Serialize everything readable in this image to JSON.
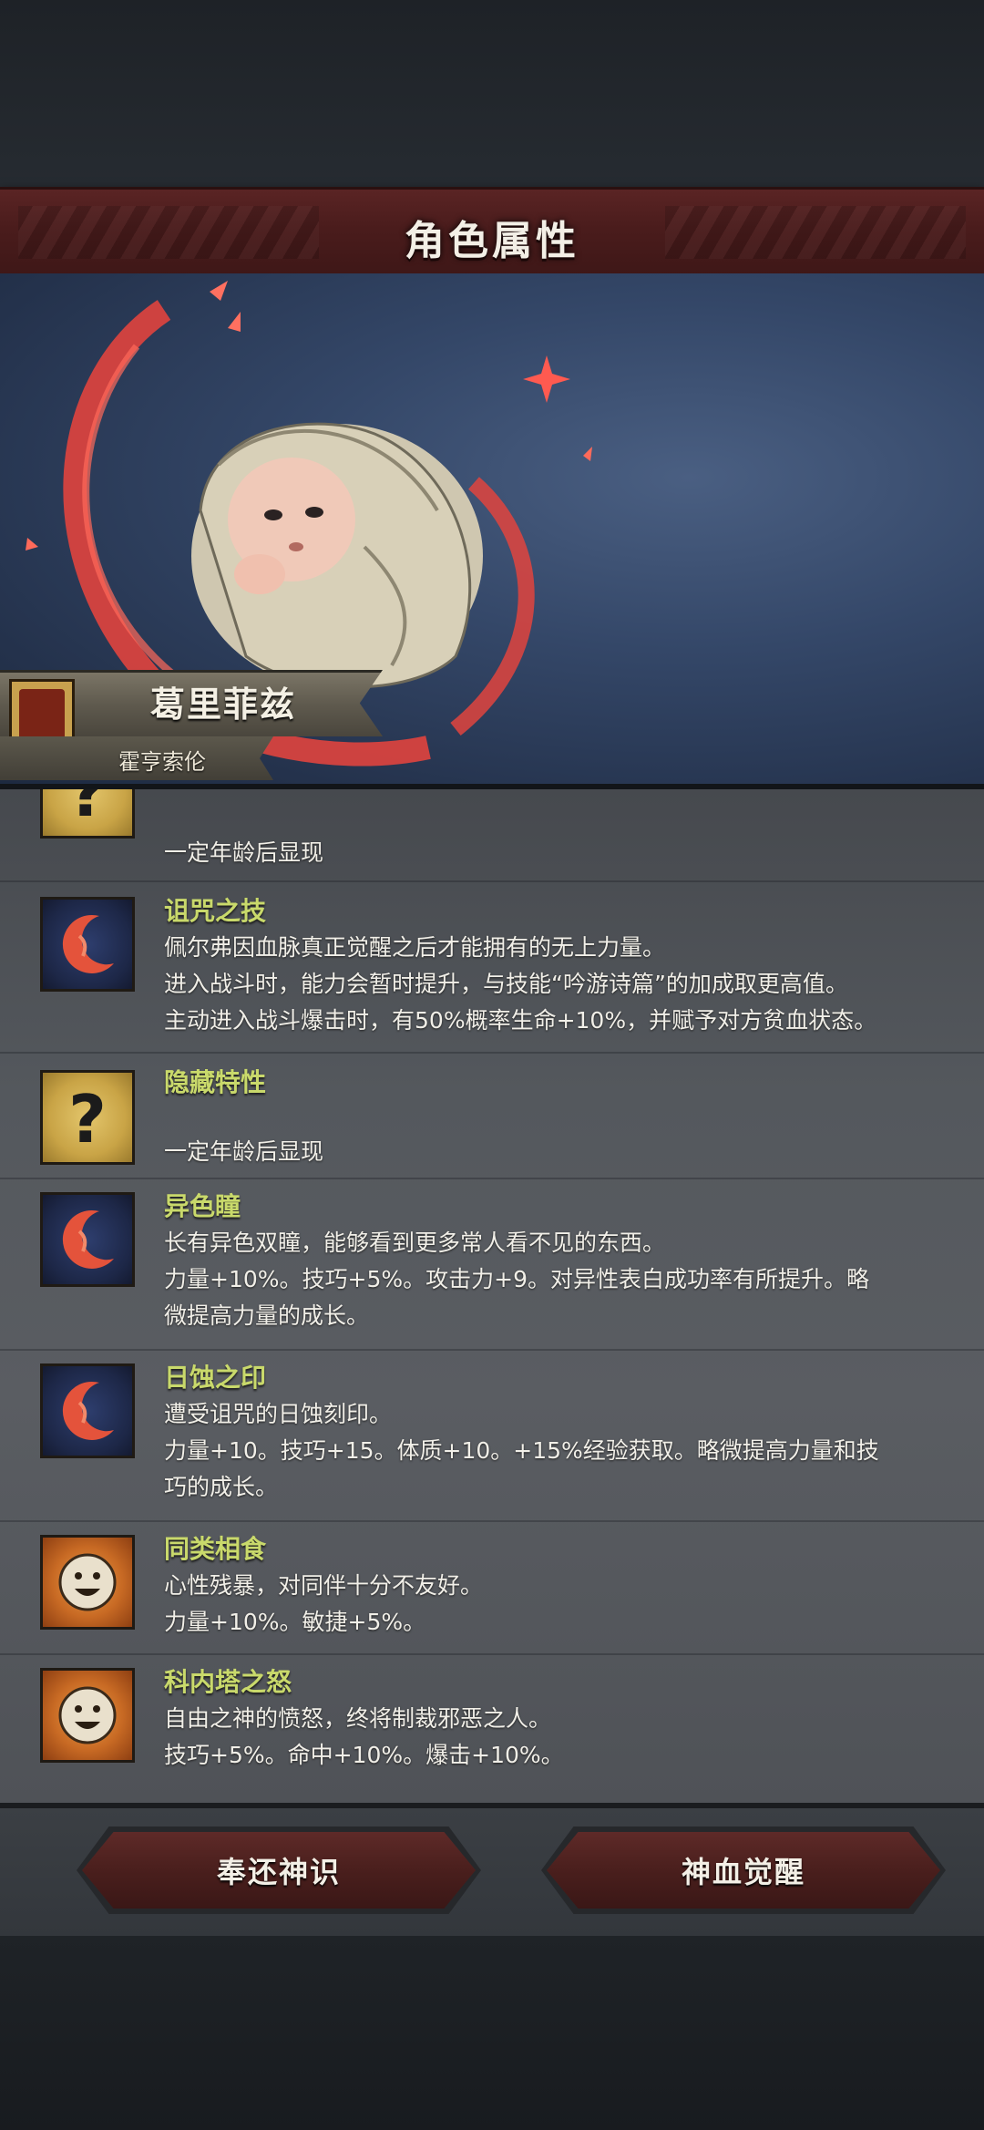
{
  "header": {
    "title": "角色属性"
  },
  "character": {
    "name": "葛里菲兹",
    "house": "霍亨索伦"
  },
  "traits": [
    {
      "icon": "question-icon",
      "name": "",
      "lines": [
        "一定年龄后显现"
      ]
    },
    {
      "icon": "crescent-flame-icon",
      "name": "诅咒之技",
      "lines": [
        "佩尔弗因血脉真正觉醒之后才能拥有的无上力量。",
        "进入战斗时，能力会暂时提升，与技能“吟游诗篇”的加成取更高值。",
        "主动进入战斗爆击时，有50%概率生命+10%，并赋予对方贫血状态。"
      ]
    },
    {
      "icon": "question-icon",
      "name": "隐藏特性",
      "lines": [
        "",
        "一定年龄后显现"
      ]
    },
    {
      "icon": "crescent-flame-icon",
      "name": "异色瞳",
      "lines": [
        "长有异色双瞳，能够看到更多常人看不见的东西。",
        "力量+10%。技巧+5%。攻击力+9。对异性表白成功率有所提升。略",
        "微提高力量的成长。"
      ]
    },
    {
      "icon": "crescent-flame-icon",
      "name": "日蚀之印",
      "lines": [
        "遭受诅咒的日蚀刻印。",
        "力量+10。技巧+15。体质+10。+15%经验获取。略微提高力量和技",
        "巧的成长。"
      ]
    },
    {
      "icon": "smile-face-icon",
      "name": "同类相食",
      "lines": [
        "心性残暴，对同伴十分不友好。",
        "力量+10%。敏捷+5%。"
      ]
    },
    {
      "icon": "smile-face-icon",
      "name": "科内塔之怒",
      "lines": [
        "自由之神的愤怒，终将制裁邪恶之人。",
        "技巧+5%。命中+10%。爆击+10%。"
      ]
    }
  ],
  "buttons": {
    "return_label": "奉还神识",
    "awaken_label": "神血觉醒"
  },
  "colors": {
    "trait_name": "#c9d96b",
    "header_bar": "#4a1c1c",
    "button": "#4a1f1d"
  }
}
